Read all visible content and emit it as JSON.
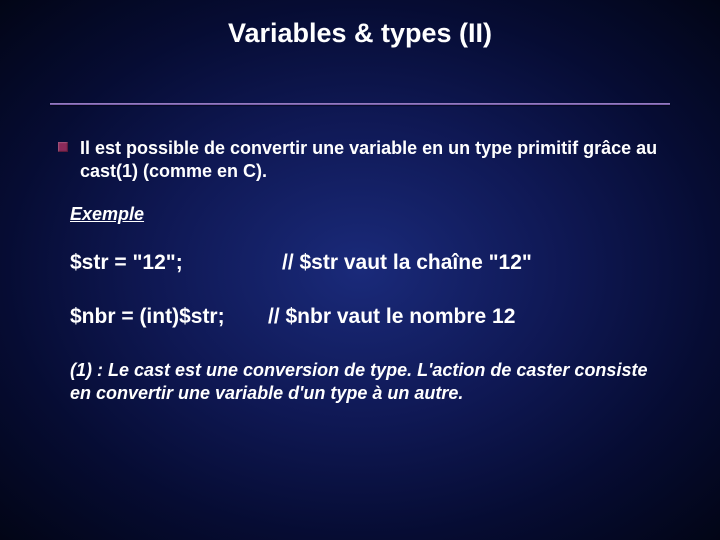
{
  "title": "Variables & types (II)",
  "bullet": "Il est possible de convertir une variable en un type primitif grâce au cast(1) (comme en C).",
  "section_label": "Exemple",
  "code1": {
    "stmt": "$str = \"12\";",
    "comment": "// $str vaut la chaîne \"12\""
  },
  "code2": {
    "stmt": "$nbr = (int)$str;",
    "comment": "// $nbr vaut le nombre 12"
  },
  "footnote": "(1) : Le cast est une conversion de type. L'action de caster consiste en convertir une variable d'un type à un autre."
}
